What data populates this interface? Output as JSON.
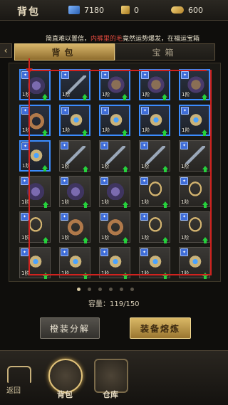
{
  "header": {
    "title": "背包",
    "resources": [
      {
        "icon": "diamond-icon",
        "value": "7180"
      },
      {
        "icon": "gold-ticket-icon",
        "value": "0"
      },
      {
        "icon": "gold-ingot-icon",
        "value": "600"
      }
    ]
  },
  "ticker": {
    "prefix": "简直难以置信，",
    "highlight": "内裤里的毛",
    "suffix": "竟然运势爆发，在福运宝箱"
  },
  "tabs": [
    {
      "label": "背包",
      "active": true
    },
    {
      "label": "宝箱",
      "active": false
    }
  ],
  "bag": {
    "items": [
      {
        "type": "bracer",
        "level": "1阶",
        "highlight": true
      },
      {
        "type": "spear",
        "level": "1阶",
        "highlight": true
      },
      {
        "type": "gauntlet",
        "level": "1阶",
        "highlight": true
      },
      {
        "type": "gauntlet",
        "level": "1阶",
        "highlight": true
      },
      {
        "type": "gauntlet",
        "level": "1阶",
        "highlight": true
      },
      {
        "type": "belt",
        "level": "1阶",
        "highlight": true
      },
      {
        "type": "ring",
        "level": "1阶",
        "highlight": true
      },
      {
        "type": "ring",
        "level": "1阶",
        "highlight": true
      },
      {
        "type": "ring",
        "level": "1阶",
        "highlight": true
      },
      {
        "type": "ring",
        "level": "1阶",
        "highlight": true
      },
      {
        "type": "ring",
        "level": "1阶",
        "highlight": true
      },
      {
        "type": "spear",
        "level": "1阶",
        "highlight": false
      },
      {
        "type": "spear",
        "level": "1阶",
        "highlight": false
      },
      {
        "type": "spear",
        "level": "1阶",
        "highlight": false
      },
      {
        "type": "spear",
        "level": "1阶",
        "highlight": false
      },
      {
        "type": "bracer",
        "level": "1阶",
        "highlight": false
      },
      {
        "type": "bracer",
        "level": "1阶",
        "highlight": false
      },
      {
        "type": "bracer",
        "level": "1阶",
        "highlight": false
      },
      {
        "type": "necklace",
        "level": "1阶",
        "highlight": false
      },
      {
        "type": "necklace",
        "level": "1阶",
        "highlight": false
      },
      {
        "type": "necklace",
        "level": "1阶",
        "highlight": false
      },
      {
        "type": "belt",
        "level": "1阶",
        "highlight": false
      },
      {
        "type": "belt",
        "level": "1阶",
        "highlight": false
      },
      {
        "type": "necklace",
        "level": "1阶",
        "highlight": false
      },
      {
        "type": "necklace",
        "level": "1阶",
        "highlight": false
      },
      {
        "type": "ring",
        "level": "1阶",
        "highlight": false
      },
      {
        "type": "ring",
        "level": "1阶",
        "highlight": false
      },
      {
        "type": "ring",
        "level": "1阶",
        "highlight": false
      },
      {
        "type": "ring",
        "level": "1阶",
        "highlight": false
      },
      {
        "type": "ring",
        "level": "1阶",
        "highlight": false
      }
    ]
  },
  "pagination": {
    "pages": 6,
    "current": 1
  },
  "capacity": "容量：119/150",
  "actions": {
    "decompose": "橙装分解",
    "smelt": "装备熔炼"
  },
  "bottom_nav": {
    "back": "返回",
    "bag": "背包",
    "warehouse": "仓库"
  },
  "colors": {
    "accent_gold": "#d7b56a",
    "highlight_blue": "#3b8cff",
    "upgrade_green": "#25d13c",
    "guide_red": "#d1221e"
  }
}
